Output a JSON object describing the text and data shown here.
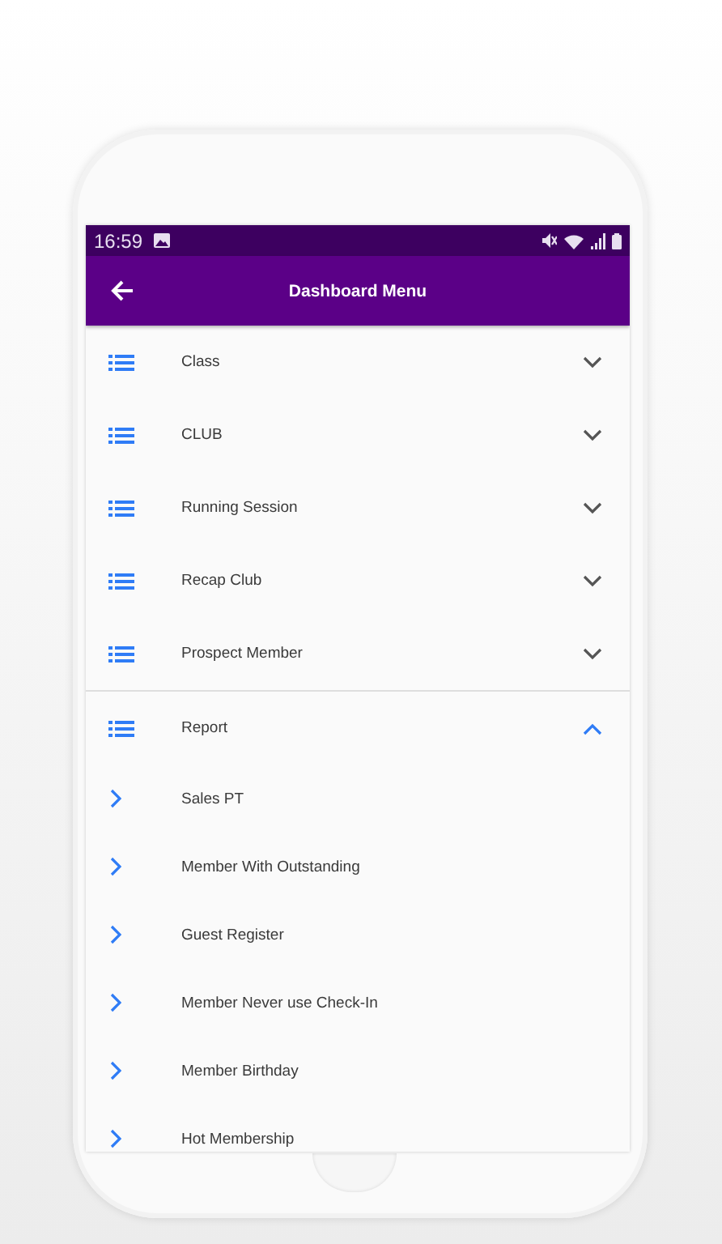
{
  "status_bar": {
    "time": "16:59"
  },
  "app_bar": {
    "title": "Dashboard Menu"
  },
  "menu": [
    {
      "label": "Class",
      "expanded": false
    },
    {
      "label": "CLUB",
      "expanded": false
    },
    {
      "label": "Running Session",
      "expanded": false
    },
    {
      "label": "Recap Club",
      "expanded": false
    },
    {
      "label": "Prospect Member",
      "expanded": false
    },
    {
      "label": "Report",
      "expanded": true,
      "children": [
        {
          "label": "Sales PT"
        },
        {
          "label": "Member With Outstanding"
        },
        {
          "label": "Guest Register"
        },
        {
          "label": "Member Never use Check-In"
        },
        {
          "label": "Member Birthday"
        },
        {
          "label": "Hot Membership"
        }
      ]
    }
  ]
}
